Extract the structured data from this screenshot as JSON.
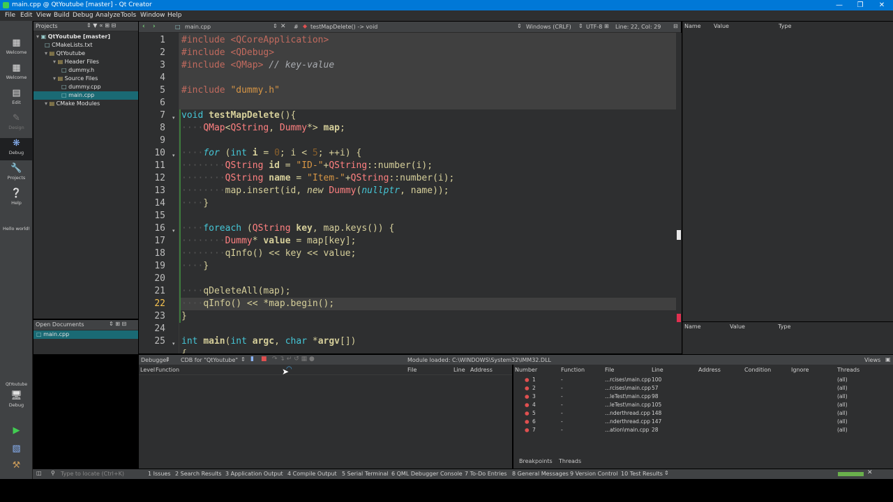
{
  "window": {
    "title": "main.cpp @ QtYoutube [master] - Qt Creator"
  },
  "menus": [
    "File",
    "Edit",
    "View",
    "Build",
    "Debug",
    "Analyze",
    "Tools",
    "Window",
    "Help"
  ],
  "modes": [
    {
      "label": "Welcome",
      "icon": "grid"
    },
    {
      "label": "Welcome",
      "icon": "grid"
    },
    {
      "label": "Edit",
      "icon": "doc"
    },
    {
      "label": "Design",
      "icon": "pen"
    },
    {
      "label": "Debug",
      "icon": "bug"
    },
    {
      "label": "Projects",
      "icon": "wrench"
    },
    {
      "label": "Help",
      "icon": "question"
    },
    {
      "label": "Hello world!",
      "icon": ""
    }
  ],
  "kit": {
    "project": "QtYoutube",
    "mode": "Debug"
  },
  "projects": {
    "header": "Projects",
    "tree": [
      {
        "label": "QtYoutube [master]",
        "indent": 0,
        "kind": "project"
      },
      {
        "label": "CMakeLists.txt",
        "indent": 1,
        "kind": "file"
      },
      {
        "label": "QtYoutube",
        "indent": 1,
        "kind": "folder"
      },
      {
        "label": "Header Files",
        "indent": 2,
        "kind": "folder"
      },
      {
        "label": "dummy.h",
        "indent": 3,
        "kind": "file"
      },
      {
        "label": "Source Files",
        "indent": 2,
        "kind": "folder"
      },
      {
        "label": "dummy.cpp",
        "indent": 3,
        "kind": "file"
      },
      {
        "label": "main.cpp",
        "indent": 3,
        "kind": "file",
        "selected": true
      },
      {
        "label": "CMake Modules",
        "indent": 1,
        "kind": "folder"
      }
    ]
  },
  "open_documents": {
    "header": "Open Documents",
    "items": [
      "main.cpp"
    ]
  },
  "editor": {
    "file": "main.cpp",
    "symbol": "testMapDelete() -> void",
    "line_ending": "Windows (CRLF)",
    "encoding": "UTF-8",
    "position": "Line: 22, Col: 29",
    "hash": "#",
    "line_numbers": [
      "1",
      "2",
      "3",
      "4",
      "5",
      "6",
      "7",
      "8",
      "9",
      "10",
      "11",
      "12",
      "13",
      "14",
      "15",
      "16",
      "17",
      "18",
      "19",
      "20",
      "21",
      "22",
      "23",
      "24",
      "25"
    ],
    "current_line": "22"
  },
  "locals": {
    "columns": [
      "Name",
      "Value",
      "Type"
    ]
  },
  "watchers": {
    "columns": [
      "Name",
      "Value",
      "Type"
    ]
  },
  "debugger": {
    "label": "Debugger",
    "engine": "CDB for \"QtYoutube\"",
    "module_msg": "Module loaded: C:\\WINDOWS\\System32\\IMM32.DLL",
    "views": "Views",
    "stack_columns": [
      "Level",
      "Function",
      "File",
      "Line",
      "Address"
    ],
    "bp_columns": [
      "Number",
      "Function",
      "File",
      "Line",
      "Address",
      "Condition",
      "Ignore",
      "Threads"
    ],
    "breakpoints": [
      {
        "num": "1",
        "fn": "-",
        "file": "...rcises\\main.cpp",
        "line": "100",
        "threads": "(all)"
      },
      {
        "num": "2",
        "fn": "-",
        "file": "...rcises\\main.cpp",
        "line": "57",
        "threads": "(all)"
      },
      {
        "num": "3",
        "fn": "-",
        "file": "...leTest\\main.cpp",
        "line": "98",
        "threads": "(all)"
      },
      {
        "num": "4",
        "fn": "-",
        "file": "...leTest\\main.cpp",
        "line": "105",
        "threads": "(all)"
      },
      {
        "num": "5",
        "fn": "-",
        "file": "...nderthread.cpp",
        "line": "148",
        "threads": "(all)"
      },
      {
        "num": "6",
        "fn": "-",
        "file": "...nderthread.cpp",
        "line": "147",
        "threads": "(all)"
      },
      {
        "num": "7",
        "fn": "-",
        "file": "...ation\\main.cpp",
        "line": "28",
        "threads": "(all)"
      }
    ],
    "tabs": [
      "Breakpoints",
      "Threads"
    ]
  },
  "status": {
    "locate_placeholder": "Type to locate (Ctrl+K)",
    "tabs": [
      "1  Issues",
      "2  Search Results",
      "3  Application Output",
      "4  Compile Output",
      "5  Serial Terminal",
      "6  QML Debugger Console",
      "7  To-Do Entries",
      "8  General Messages",
      "9  Version Control",
      "10  Test Results"
    ]
  },
  "colors": {
    "accent": "#0078d7",
    "selection": "#1a6a74",
    "breakpoint": "#e05050"
  }
}
